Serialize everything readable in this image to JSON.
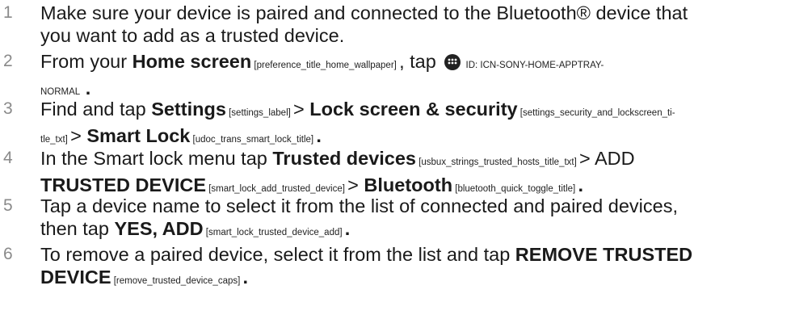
{
  "steps": [
    {
      "number": "1",
      "line1": "Make sure your device is paired and connected to the Bluetooth® device that",
      "line2": "you want to add as a trusted device."
    },
    {
      "number": "2",
      "pre": "From your ",
      "home": "Home screen",
      "home_id": " [preference_title_home_wallpaper] ",
      "mid": ", tap ",
      "icon_name": "app-tray-icon",
      "icon_id_line1": " ID: ICN-SONY-HOME-APPTRAY-",
      "icon_id_line2": "NORMAL",
      "end": " ."
    },
    {
      "number": "3",
      "pre": "Find and tap ",
      "settings": "Settings",
      "settings_id": " [settings_label] ",
      "sep1": "> ",
      "lock": "Lock screen & security",
      "lock_id_line1": " [settings_security_and_lockscreen_ti-",
      "lock_id_line2": "tle_txt] ",
      "sep2": "> ",
      "smart": "Smart Lock",
      "smart_id": " [udoc_trans_smart_lock_title] ",
      "end": "."
    },
    {
      "number": "4",
      "pre": "In the Smart lock menu tap ",
      "trusted": "Trusted devices",
      "trusted_id": " [usbux_strings_trusted_hosts_title_txt] ",
      "sep1": "> ",
      "add_line1": "ADD",
      "add_line2": "TRUSTED DEVICE",
      "add_id": " [smart_lock_add_trusted_device] ",
      "sep2": "> ",
      "bt": "Bluetooth",
      "bt_id": " [bluetooth_quick_toggle_title] ",
      "end": "."
    },
    {
      "number": "5",
      "line1": "Tap a device name to select it from the list of connected and paired devices,",
      "pre2": "then tap ",
      "yes": "YES, ADD",
      "yes_id": " [smart_lock_trusted_device_add] ",
      "end": "."
    },
    {
      "number": "6",
      "pre": "To remove a paired device, select it from the list and tap ",
      "remove_line1": "REMOVE TRUSTED",
      "remove_line2": "DEVICE",
      "remove_id": " [remove_trusted_device_caps] ",
      "end": "."
    }
  ]
}
